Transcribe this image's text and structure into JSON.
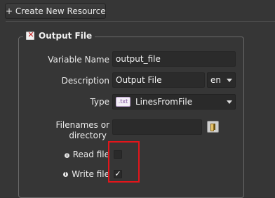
{
  "toolbar": {
    "create_label": "+ Create New Resource"
  },
  "section": {
    "title": "Output File",
    "fields": {
      "variable_name": {
        "label": "Variable Name",
        "value": "output_file"
      },
      "description": {
        "label": "Description",
        "value": "Output File",
        "lang": "en"
      },
      "type": {
        "label": "Type",
        "badge": ".txt",
        "value": "LinesFromFile"
      },
      "filenames": {
        "label_line1": "Filenames or",
        "label_line2": "directory",
        "value": ""
      },
      "read_file": {
        "label": "Read file",
        "checked": false,
        "mark": ""
      },
      "write_file": {
        "label": "Write file",
        "checked": true,
        "mark": "✓"
      }
    }
  },
  "colors": {
    "highlight": "#e3151a",
    "background": "#363636"
  },
  "icons": [
    "plus-icon",
    "delete-x-icon",
    "txt-file-icon",
    "dropdown-caret-icon",
    "folder-browse-icon",
    "info-icon"
  ]
}
